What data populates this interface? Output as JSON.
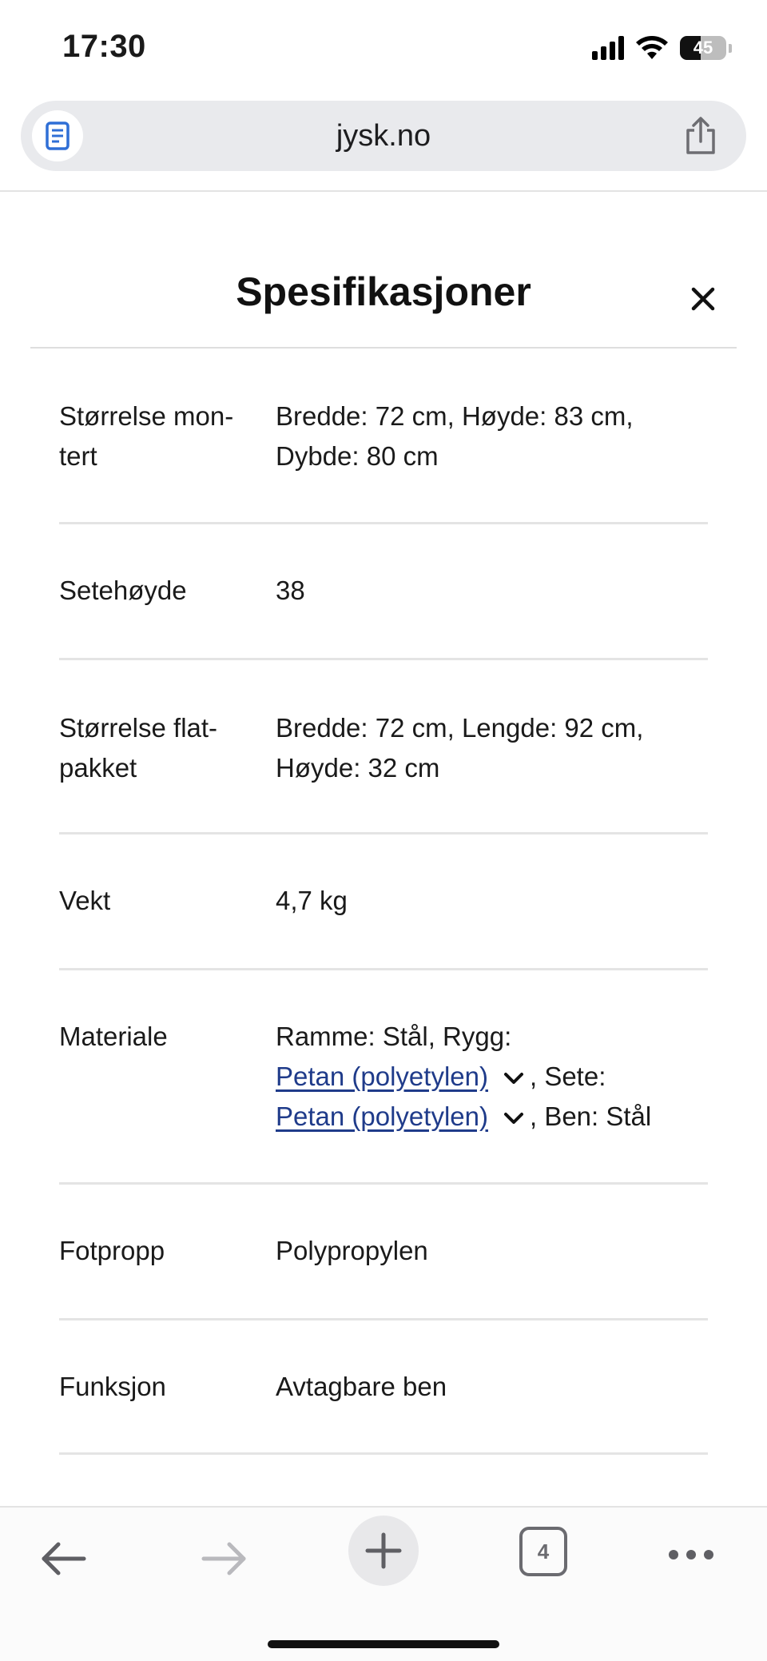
{
  "status_bar": {
    "time": "17:30",
    "battery": "45",
    "battery_level": 0.45,
    "icons": [
      "signal-icon",
      "wifi-icon",
      "battery-icon"
    ]
  },
  "browser": {
    "url": "jysk.no",
    "icons": [
      "reader-icon",
      "share-icon"
    ]
  },
  "modal": {
    "title": "Spesifikasjoner",
    "close_icon": "close-icon"
  },
  "specs": [
    {
      "label": "Størrelse mon-tert",
      "label_lines": [
        "Størrelse mon-",
        "tert"
      ],
      "value_lines": [
        "Bredde: 72 cm, Høyde: 83 cm,",
        "Dybde: 80 cm"
      ]
    },
    {
      "label": "Setehøyde",
      "value": "38"
    },
    {
      "label": "Størrelse flat-pakket",
      "label_lines": [
        "Størrelse flat-",
        "pakket"
      ],
      "value_lines": [
        "Bredde: 72 cm, Lengde: 92 cm,",
        "Høyde: 32 cm"
      ]
    },
    {
      "label": "Vekt",
      "value": "4,7 kg"
    },
    {
      "label": "Materiale",
      "value_parts": {
        "line1": "Ramme: Stål, Rygg:",
        "link1": "Petan (polyetylen)",
        "after1": ", Sete:",
        "link2": "Petan (polyetylen)",
        "after2": ", Ben: Stål"
      }
    },
    {
      "label": "Fotpropp",
      "value": "Polypropylen"
    },
    {
      "label": "Funksjon",
      "value": "Avtagbare ben"
    }
  ],
  "toolbar": {
    "tab_count": "4",
    "icons": [
      "back-arrow-icon",
      "forward-arrow-icon",
      "plus-icon",
      "tabs-icon",
      "more-icon"
    ]
  },
  "colors": {
    "link": "#1f3b8a",
    "divider": "#e4e4e4",
    "address_bar_bg": "#e9eaed"
  }
}
